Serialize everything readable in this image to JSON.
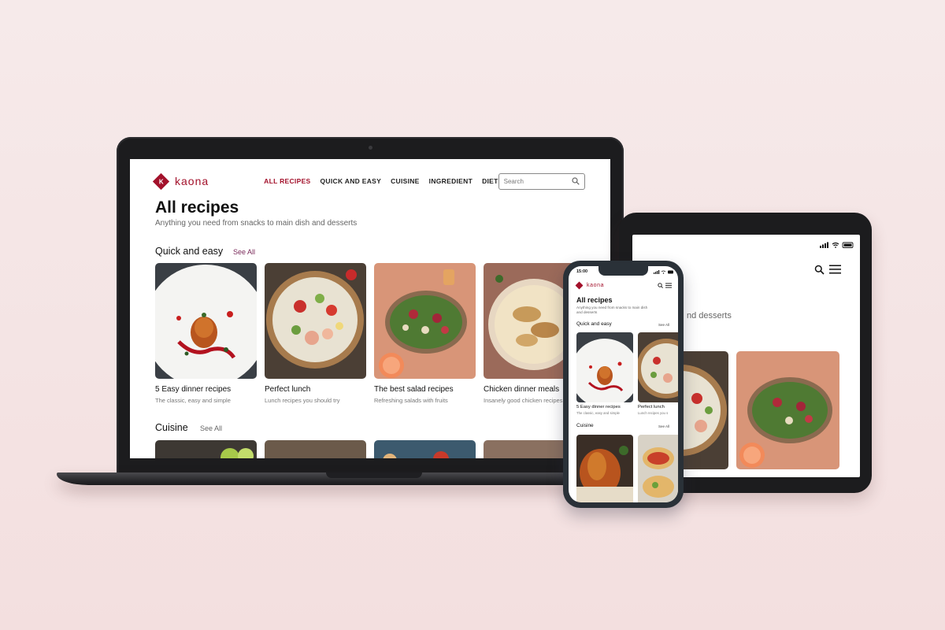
{
  "brand": {
    "name": "kaona",
    "initial": "K",
    "color": "#a3112b"
  },
  "desktop": {
    "nav": [
      "ALL RECIPES",
      "QUICK AND EASY",
      "CUISINE",
      "INGREDIENT",
      "DIET"
    ],
    "search_placeholder": "Search",
    "title": "All recipes",
    "subtitle": "Anything you need from snacks to main dish and desserts",
    "sections": [
      {
        "title": "Quick and easy",
        "see_all": "See All",
        "cards": [
          {
            "title": "5 Easy dinner recipes",
            "subtitle": "The classic, easy and simple"
          },
          {
            "title": "Perfect lunch",
            "subtitle": "Lunch recipes you should try"
          },
          {
            "title": "The best salad recipes",
            "subtitle": "Refreshing salads with fruits"
          },
          {
            "title": "Chicken dinner meals",
            "subtitle": "Insanely good chicken recipes"
          }
        ]
      },
      {
        "title": "Cuisine",
        "see_all": "See All"
      }
    ]
  },
  "tablet": {
    "subtitle_partial": "nd desserts"
  },
  "phone": {
    "time": "15:00",
    "title": "All recipes",
    "subtitle": "Anything you need from snacks to main dish and desserts",
    "subtitle_line1": "Anything you need from snacks to main dish",
    "subtitle_line2": "and desserts",
    "sections": [
      {
        "title": "Quick and easy",
        "see_all": "See All",
        "cards": [
          {
            "title": "5 Easy dinner recipes",
            "subtitle": "The classic, easy and simple"
          },
          {
            "title": "Perfect lunch",
            "subtitle": "Lunch recipes you s"
          }
        ]
      },
      {
        "title": "Cuisine",
        "see_all": "See All"
      }
    ]
  }
}
